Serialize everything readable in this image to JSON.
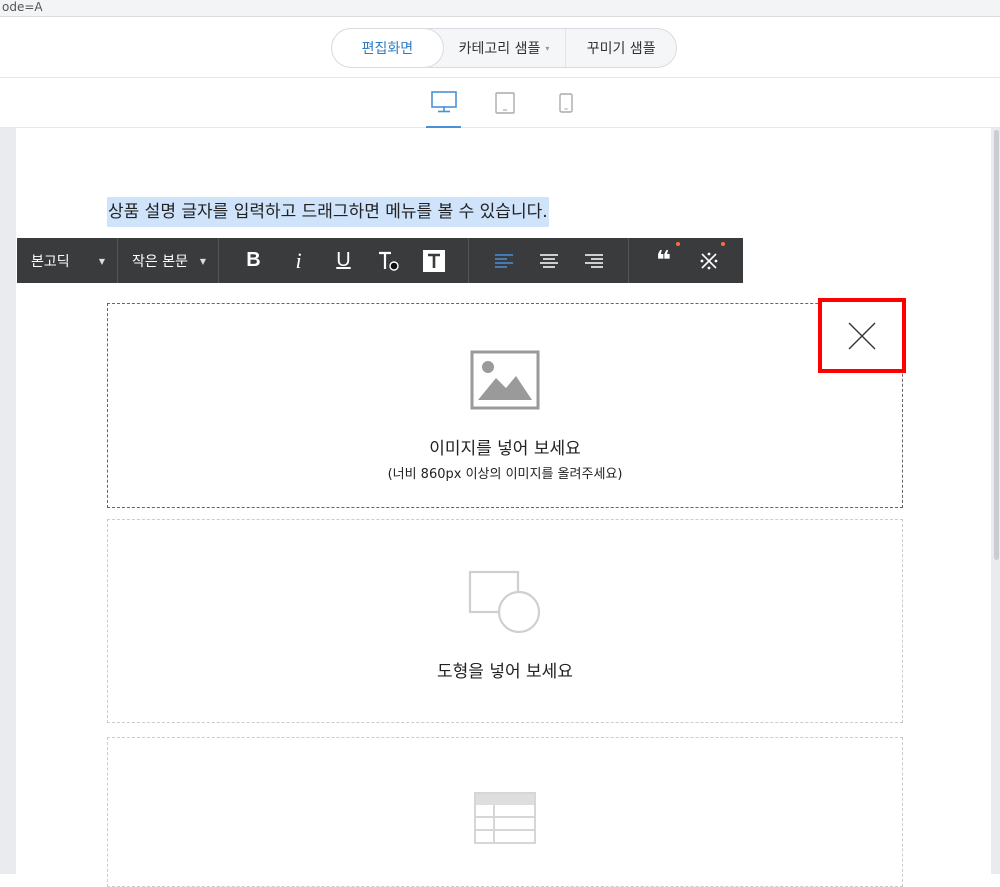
{
  "url_fragment": "ode=A",
  "top_tabs": [
    {
      "label": "편집화면",
      "active": true
    },
    {
      "label": "카테고리 샘플",
      "caret": "▾"
    },
    {
      "label": "꾸미기 샘플"
    }
  ],
  "device_buttons": [
    {
      "name": "desktop-view-icon",
      "active": true
    },
    {
      "name": "tablet-view-icon",
      "active": false
    },
    {
      "name": "mobile-view-icon",
      "active": false
    }
  ],
  "description_text": "상품 설명 글자를 입력하고 드래그하면 메뉴를 볼 수 있습니다.",
  "toolbar": {
    "font_family": "본고딕",
    "font_size": "작은 본문",
    "bold": "B",
    "italic": "i",
    "underline": "U",
    "quote": "❝"
  },
  "image_block": {
    "title": "이미지를 넣어 보세요",
    "subtitle": "(너비 860px 이상의 이미지를 올려주세요)"
  },
  "shape_block": {
    "title": "도형을 넣어 보세요"
  },
  "colors": {
    "accent": "#2f7cc4",
    "toolbar_bg": "#3a3b3d",
    "selection": "#cfe3fb",
    "highlight_border": "#ff0000"
  }
}
